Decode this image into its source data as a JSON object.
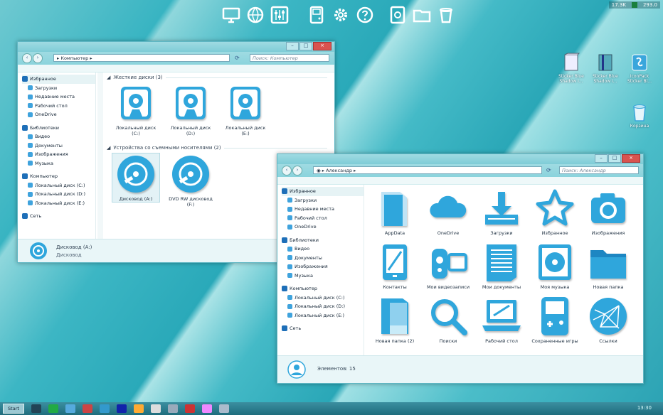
{
  "top_dock": {
    "icons": [
      "monitor-icon",
      "globe-icon",
      "equalizer-icon",
      "gameboy-icon",
      "settings-gear-icon",
      "help-icon",
      "drive-icon",
      "folder-icon",
      "trash-icon"
    ]
  },
  "tray_top": {
    "left_value": "17.3K",
    "right_value": "293.0"
  },
  "desktop_icons": [
    {
      "label": "Sticker Blue Shadow i..."
    },
    {
      "label": "Sticker Blue Shadow i..."
    },
    {
      "label": "IconPack Sticker Bl..."
    },
    {
      "label": "Корзина"
    }
  ],
  "win1": {
    "address": "Компьютер",
    "search_placeholder": "Поиск: Компьютер",
    "nav": [
      {
        "label": "Избранное",
        "kind": "header"
      },
      {
        "label": "Загрузки"
      },
      {
        "label": "Недавние места"
      },
      {
        "label": "Рабочий стол"
      },
      {
        "label": "OneDrive"
      },
      {
        "label": "",
        "kind": "gap"
      },
      {
        "label": "Библиотеки",
        "kind": "header"
      },
      {
        "label": "Видео"
      },
      {
        "label": "Документы"
      },
      {
        "label": "Изображения"
      },
      {
        "label": "Музыка"
      },
      {
        "label": "",
        "kind": "gap"
      },
      {
        "label": "Компьютер",
        "kind": "header"
      },
      {
        "label": "Локальный диск (C:)"
      },
      {
        "label": "Локальный диск (D:)"
      },
      {
        "label": "Локальный диск (E:)"
      },
      {
        "label": "",
        "kind": "gap"
      },
      {
        "label": "Сеть",
        "kind": "header"
      }
    ],
    "group_hdd": "Жесткие диски (3)",
    "group_removable": "Устройства со съемными носителями (2)",
    "disks": [
      {
        "label": "Локальный диск (C:)"
      },
      {
        "label": "Локальный диск (D:)"
      },
      {
        "label": "Локальный диск (E:)"
      }
    ],
    "removable": [
      {
        "label": "Дисковод (A:)"
      },
      {
        "label": "DVD RW дисковод (F:)"
      }
    ],
    "status_name": "Дисковод (A:)",
    "status_type": "Дисковод"
  },
  "win2": {
    "address": "Александр",
    "search_placeholder": "Поиск: Александр",
    "nav": [
      {
        "label": "Избранное",
        "kind": "header"
      },
      {
        "label": "Загрузки"
      },
      {
        "label": "Недавние места"
      },
      {
        "label": "Рабочий стол"
      },
      {
        "label": "OneDrive"
      },
      {
        "label": "",
        "kind": "gap"
      },
      {
        "label": "Библиотеки",
        "kind": "header"
      },
      {
        "label": "Видео"
      },
      {
        "label": "Документы"
      },
      {
        "label": "Изображения"
      },
      {
        "label": "Музыка"
      },
      {
        "label": "",
        "kind": "gap"
      },
      {
        "label": "Компьютер",
        "kind": "header"
      },
      {
        "label": "Локальный диск (C:)"
      },
      {
        "label": "Локальный диск (D:)"
      },
      {
        "label": "Локальный диск (E:)"
      },
      {
        "label": "",
        "kind": "gap"
      },
      {
        "label": "Сеть",
        "kind": "header"
      }
    ],
    "items": [
      {
        "label": "AppData",
        "icon": "appdata-folder-icon"
      },
      {
        "label": "OneDrive",
        "icon": "cloud-icon"
      },
      {
        "label": "Загрузки",
        "icon": "download-icon"
      },
      {
        "label": "Избранное",
        "icon": "star-icon"
      },
      {
        "label": "Изображения",
        "icon": "camera-icon"
      },
      {
        "label": "Контакты",
        "icon": "contacts-icon"
      },
      {
        "label": "Мои видеозаписи",
        "icon": "video-camera-icon"
      },
      {
        "label": "Мои документы",
        "icon": "document-icon"
      },
      {
        "label": "Моя музыка",
        "icon": "music-disc-icon"
      },
      {
        "label": "Новая папка",
        "icon": "folder-icon"
      },
      {
        "label": "Новая папка (2)",
        "icon": "folder-book-icon"
      },
      {
        "label": "Поиски",
        "icon": "magnifier-icon"
      },
      {
        "label": "Рабочий стол",
        "icon": "laptop-icon"
      },
      {
        "label": "Сохраненные игры",
        "icon": "gameboy-icon"
      },
      {
        "label": "Ссылки",
        "icon": "network-globe-icon"
      }
    ],
    "status": "Элементов: 15"
  },
  "taskbar": {
    "start_label": "Start",
    "clock": "13:30"
  },
  "colors": {
    "accent": "#2fa6dc",
    "accent_dark": "#1d86c2",
    "window_bg": "#ffffff"
  }
}
